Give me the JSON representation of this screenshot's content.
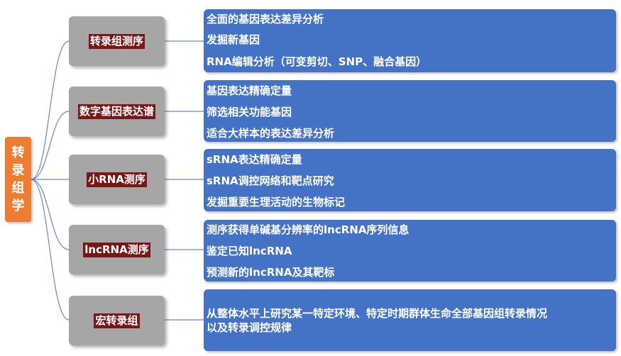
{
  "root": {
    "label": "转录组学"
  },
  "branches": [
    {
      "category": "转录组测序",
      "details": [
        "全面的基因表达差异分析",
        "发掘新基因",
        "RNA编辑分析（可变剪切、SNP、融合基因）"
      ]
    },
    {
      "category": "数字基因表达谱",
      "details": [
        "基因表达精确定量",
        "筛选相关功能基因",
        "适合大样本的表达差异分析"
      ]
    },
    {
      "category": "小RNA测序",
      "details": [
        "sRNA表达精确定量",
        "sRNA调控网络和靶点研究",
        "发掘重要生理活动的生物标记"
      ]
    },
    {
      "category": "lncRNA测序",
      "details": [
        "测序获得单碱基分辨率的lncRNA序列信息",
        "鉴定已知lncRNA",
        "预测新的lncRNA及其靶标"
      ]
    },
    {
      "category": "宏转录组",
      "details": [
        "从整体水平上研究某一特定环境、特定时期群体生命全部基因组转录情况",
        "以及转录调控规律"
      ]
    }
  ],
  "colors": {
    "root": "#ed7d31",
    "category_box": "#a6a6a6",
    "category_label_bg": "#7b1616",
    "detail_box": "#4472c4",
    "connector": "#6f86bf"
  }
}
